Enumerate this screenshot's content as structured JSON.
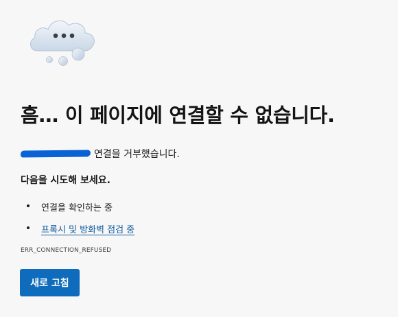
{
  "error": {
    "icon": "cloud-with-dots-icon",
    "headline": "흠… 이 페이지에 연결할 수 없습니다.",
    "refused_message": "연결을 거부했습니다.",
    "suggestion_title": "다음을 시도해 보세요.",
    "suggestions": [
      {
        "label": "연결을 확인하는 중",
        "is_link": false
      },
      {
        "label": "프록시 및 방화벽 점검 중",
        "is_link": true
      }
    ],
    "error_code": "ERR_CONNECTION_REFUSED",
    "refresh_label": "새로 고침"
  },
  "colors": {
    "background": "#f7f7f7",
    "button": "#0f6cbd",
    "link": "#0f5a9e",
    "redaction": "#0a63d6"
  }
}
